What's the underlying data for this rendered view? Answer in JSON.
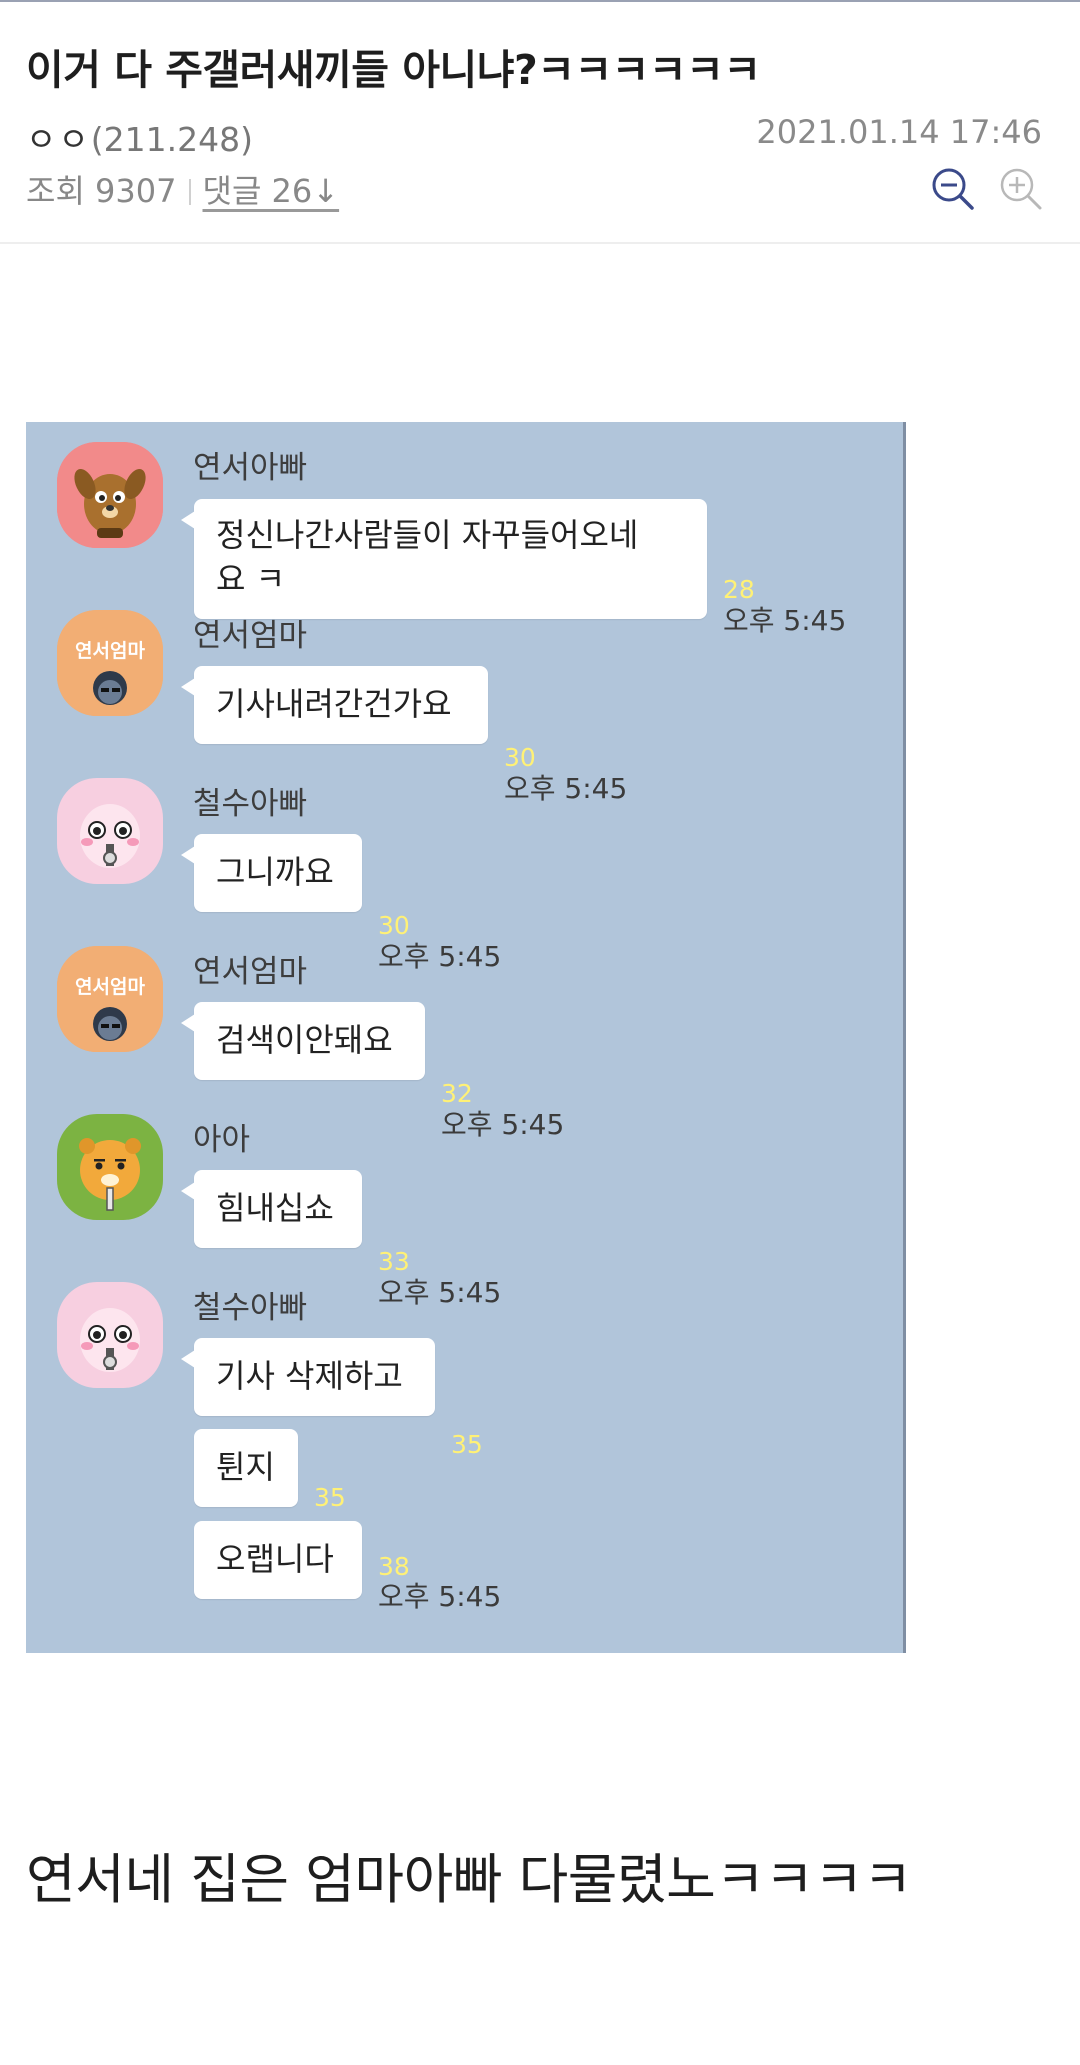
{
  "post": {
    "title": "이거 다 주갤러새끼들 아니냐?ㅋㅋㅋㅋㅋㅋ",
    "author": "ㅇㅇ",
    "author_ip": "(211.248)",
    "date": "2021.01.14 17:46",
    "views": "조회 9307",
    "comments": "댓글 26↓"
  },
  "chat": {
    "messages": [
      {
        "sender": "연서아빠",
        "avatar": "brown-dog-frodo-avatar",
        "bubbles": [
          {
            "text": "정신나간사람들이 자꾸들어오네\n요 ㅋ",
            "unread": "28",
            "time": "오후 5:45"
          }
        ]
      },
      {
        "sender": "연서엄마",
        "avatar": "yeonseo-mom-text-avatar",
        "avatar_text": "연서엄마",
        "bubbles": [
          {
            "text": "기사내려간건가요",
            "unread": "30",
            "time": "오후 5:45"
          }
        ]
      },
      {
        "sender": "철수아빠",
        "avatar": "pink-peach-apeach-avatar",
        "bubbles": [
          {
            "text": "그니까요",
            "unread": "30",
            "time": "오후 5:45"
          }
        ]
      },
      {
        "sender": "연서엄마",
        "avatar": "yeonseo-mom-text-avatar",
        "avatar_text": "연서엄마",
        "bubbles": [
          {
            "text": "검색이안돼요",
            "unread": "32",
            "time": "오후 5:45"
          }
        ]
      },
      {
        "sender": "아아",
        "avatar": "yellow-lion-ryan-avatar",
        "bubbles": [
          {
            "text": "힘내십쇼",
            "unread": "33",
            "time": "오후 5:45"
          }
        ]
      },
      {
        "sender": "철수아빠",
        "avatar": "pink-peach-apeach-avatar",
        "bubbles": [
          {
            "text": "기사 삭제하고",
            "unread": "35",
            "time": ""
          },
          {
            "text": "튄지",
            "unread": "35",
            "time": ""
          },
          {
            "text": "오랩니다",
            "unread": "38",
            "time": "오후 5:45"
          }
        ]
      }
    ]
  },
  "caption": "연서네 집은 엄마아빠 다물렸노ㅋㅋㅋㅋ",
  "colors": {
    "chat_background": "#b1c5da",
    "unread_count": "#fff176",
    "zoom_out_icon": "#3b4a8a",
    "zoom_in_icon": "#b8b8b8"
  }
}
